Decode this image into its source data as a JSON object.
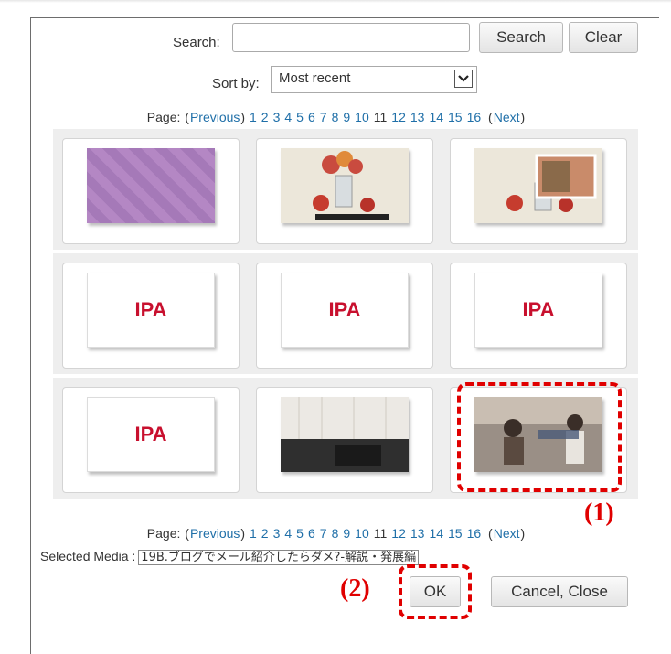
{
  "search": {
    "label": "Search:",
    "value": "",
    "placeholder": "",
    "search_button": "Search",
    "clear_button": "Clear"
  },
  "sort": {
    "label": "Sort by:",
    "selected": "Most recent"
  },
  "pager": {
    "label": "Page:",
    "previous": "Previous",
    "next": "Next",
    "pages": [
      "1",
      "2",
      "3",
      "4",
      "5",
      "6",
      "7",
      "8",
      "9",
      "10",
      "11",
      "12",
      "13",
      "14",
      "15",
      "16"
    ],
    "current": "11"
  },
  "thumbnails": [
    {
      "kind": "purple-pattern"
    },
    {
      "kind": "fruit-sketch"
    },
    {
      "kind": "fruit-sketch-overlay"
    },
    {
      "kind": "ipa-logo",
      "logo": "IPA"
    },
    {
      "kind": "ipa-logo",
      "logo": "IPA"
    },
    {
      "kind": "ipa-logo",
      "logo": "IPA"
    },
    {
      "kind": "ipa-logo",
      "logo": "IPA"
    },
    {
      "kind": "room-photo"
    },
    {
      "kind": "studio-photo",
      "selected": true
    }
  ],
  "selected_media": {
    "label": "Selected Media :",
    "value": "19B.ブログでメール紹介したらダメ?-解説・発展編"
  },
  "actions": {
    "ok": "OK",
    "cancel": "Cancel, Close"
  },
  "annotations": {
    "one": "(1)",
    "two": "(2)",
    "color": "#e00000"
  }
}
